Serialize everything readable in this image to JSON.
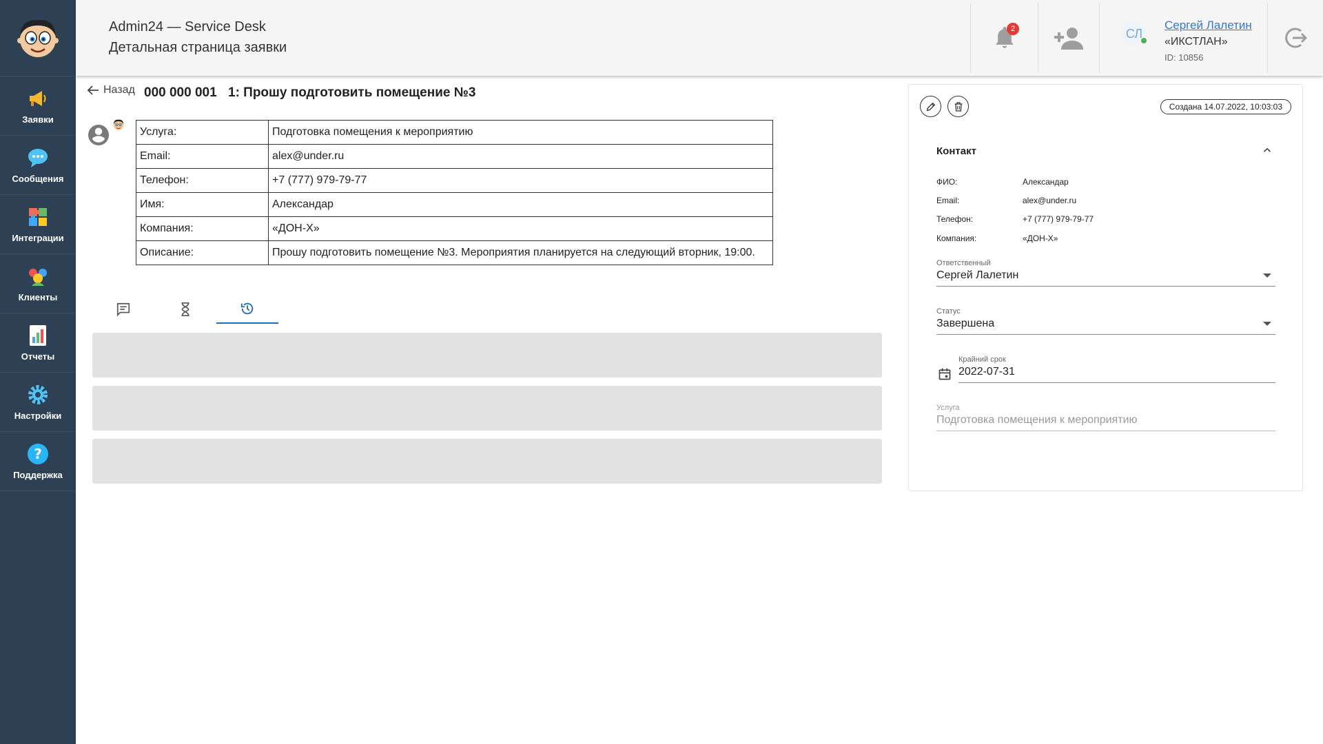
{
  "sidebar": {
    "items": [
      {
        "label": "Заявки",
        "icon": "megaphone-icon",
        "color": "#f5b82e"
      },
      {
        "label": "Сообщения",
        "icon": "chat-bubble-icon",
        "color": "#4fc3f7"
      },
      {
        "label": "Интеграции",
        "icon": "puzzle-icon",
        "color": "#ef6c57"
      },
      {
        "label": "Клиенты",
        "icon": "people-icon",
        "color": "#ef5350"
      },
      {
        "label": "Отчеты",
        "icon": "report-chart-icon",
        "color": "#ffffff"
      },
      {
        "label": "Настройки",
        "icon": "gear-icon",
        "color": "#4fc3f7"
      },
      {
        "label": "Поддержка",
        "icon": "help-icon",
        "color": "#29b6f6"
      }
    ]
  },
  "header": {
    "title": "Admin24 — Service Desk",
    "subtitle": "Детальная страница заявки",
    "notifications": "2",
    "user": {
      "initials": "СЛ",
      "name": "Сергей Лалетин",
      "company": "«ИКСТЛАН»",
      "id": "ID: 10856"
    }
  },
  "ticket": {
    "back": "Назад",
    "number": "000 000 001",
    "title": "1: Прошу подготовить помещение №3",
    "rows": [
      {
        "k": "Услуга:",
        "v": "Подготовка помещения к мероприятию"
      },
      {
        "k": "Email:",
        "v": "alex@under.ru"
      },
      {
        "k": "Телефон:",
        "v": "+7 (777) 979-79-77"
      },
      {
        "k": "Имя:",
        "v": "Александар"
      },
      {
        "k": "Компания:",
        "v": "«ДОН-Х»"
      },
      {
        "k": "Описание:",
        "v": "Прошу подготовить помещение №3. Мероприятия планируется на следующий вторник, 19:00."
      }
    ]
  },
  "panel": {
    "created": "Создана 14.07.2022, 10:03:03",
    "contact_title": "Контакт",
    "contact": [
      {
        "k": "ФИО:",
        "v": "Александар"
      },
      {
        "k": "Email:",
        "v": "alex@under.ru"
      },
      {
        "k": "Телефон:",
        "v": "+7 (777) 979-79-77"
      },
      {
        "k": "Компания:",
        "v": "«ДОН-Х»"
      }
    ],
    "responsible_label": "Ответственный",
    "responsible_value": "Сергей Лалетин",
    "status_label": "Статус",
    "status_value": "Завершена",
    "deadline_label": "Крайний срок",
    "deadline_value": "2022-07-31",
    "service_label": "Услуга",
    "service_value": "Подготовка помещения к мероприятию"
  },
  "colors": {
    "sidebar": "#2e4154",
    "accent": "#1e6bb8",
    "link": "#2f7ad8",
    "badge": "#e53935"
  }
}
